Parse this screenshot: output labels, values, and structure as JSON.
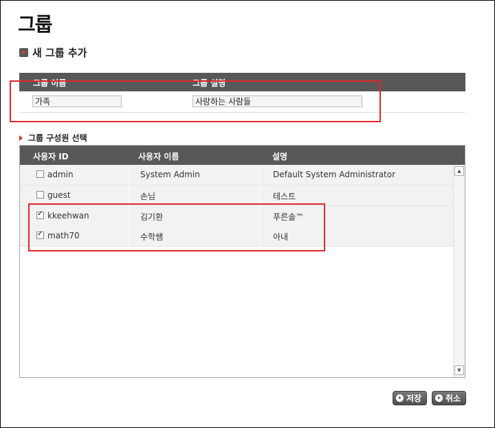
{
  "page": {
    "title": "그룹"
  },
  "new_group": {
    "section_title": "새 그룹 추가",
    "name_header": "그룹 이름",
    "desc_header": "그룹 설명",
    "name_value": "가족",
    "desc_value": "사랑하는 사람들"
  },
  "members": {
    "section_title": "그룹 구성원 선택",
    "columns": [
      "사용자 ID",
      "사용자 이름",
      "설명"
    ],
    "rows": [
      {
        "id": "admin",
        "name": "System Admin",
        "desc": "Default System Administrator",
        "checked": false
      },
      {
        "id": "guest",
        "name": "손님",
        "desc": "테스트",
        "checked": false
      },
      {
        "id": "kkeehwan",
        "name": "김기환",
        "desc": "푸른솔™",
        "checked": true
      },
      {
        "id": "math70",
        "name": "수학쌤",
        "desc": "아내",
        "checked": true
      }
    ]
  },
  "buttons": {
    "save": "저장",
    "cancel": "취소"
  },
  "colors": {
    "header_bg": "#585858",
    "highlight": "#e0262a",
    "accent_arrow": "#e8392f"
  }
}
